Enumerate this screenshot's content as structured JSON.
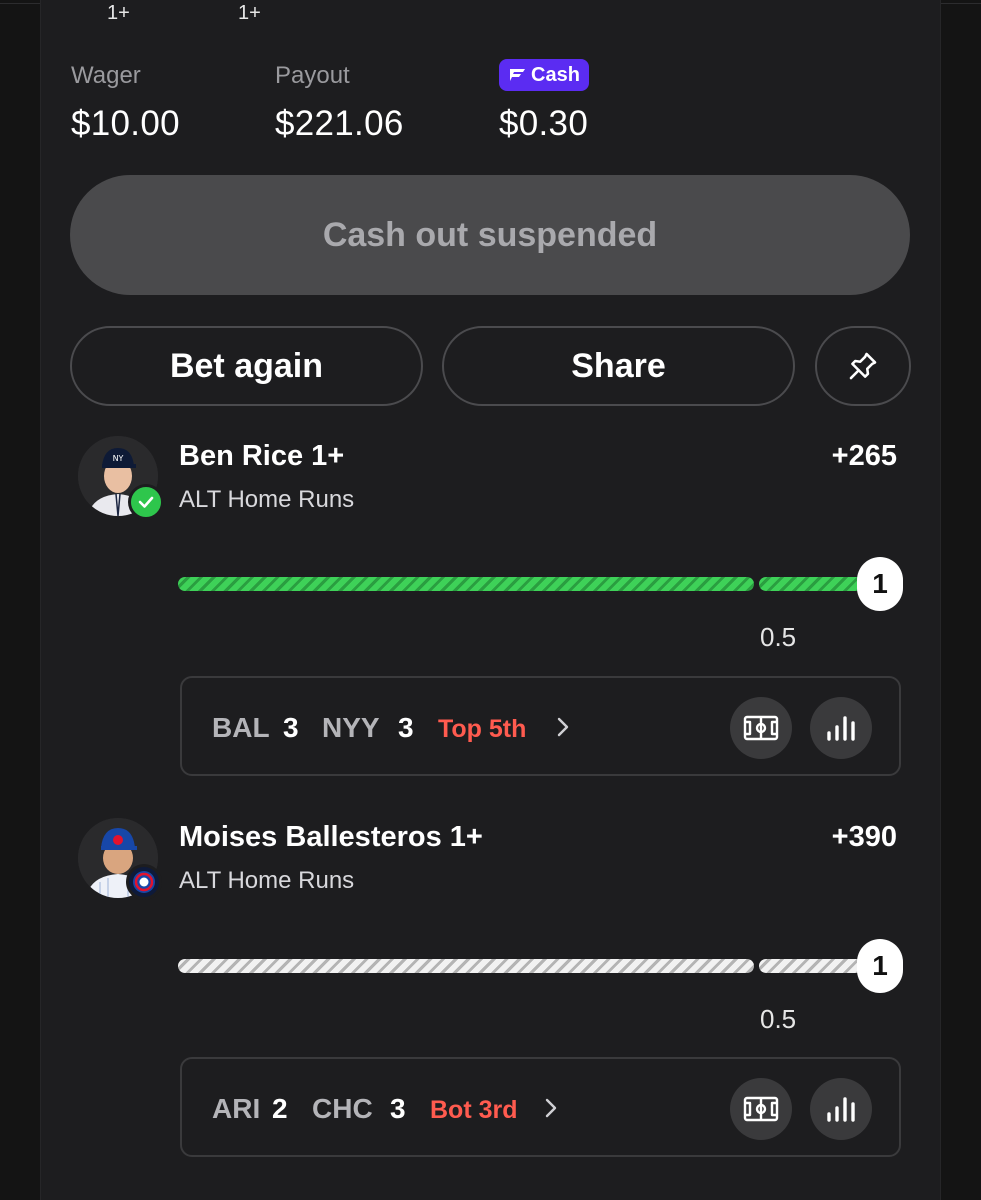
{
  "top": {
    "prev_leg_labels": [
      "1+",
      "1+"
    ]
  },
  "stats": {
    "wager_label": "Wager",
    "wager_value": "$10.00",
    "payout_label": "Payout",
    "payout_value": "$221.06",
    "cash_badge_label": "Cash",
    "cash_value": "$0.30"
  },
  "actions": {
    "cashout_label": "Cash out suspended",
    "bet_again_label": "Bet again",
    "share_label": "Share",
    "pin_icon": "pin-icon"
  },
  "legs": [
    {
      "title": "Ben Rice 1+",
      "market": "ALT Home Runs",
      "odds": "+265",
      "progress_state": "won",
      "target": "1",
      "half_mark": "0.5",
      "game": {
        "away_team": "BAL",
        "away_score": "3",
        "home_team": "NYY",
        "home_score": "3",
        "inning": "Top 5th"
      }
    },
    {
      "title": "Moises Ballesteros 1+",
      "market": "ALT Home Runs",
      "odds": "+390",
      "progress_state": "pending",
      "target": "1",
      "half_mark": "0.5",
      "game": {
        "away_team": "ARI",
        "away_score": "2",
        "home_team": "CHC",
        "home_score": "3",
        "inning": "Bot 3rd"
      }
    }
  ],
  "colors": {
    "accent_green": "#3ed158",
    "cash_purple": "#5b2cf2",
    "inning_red": "#ff5b4f"
  }
}
